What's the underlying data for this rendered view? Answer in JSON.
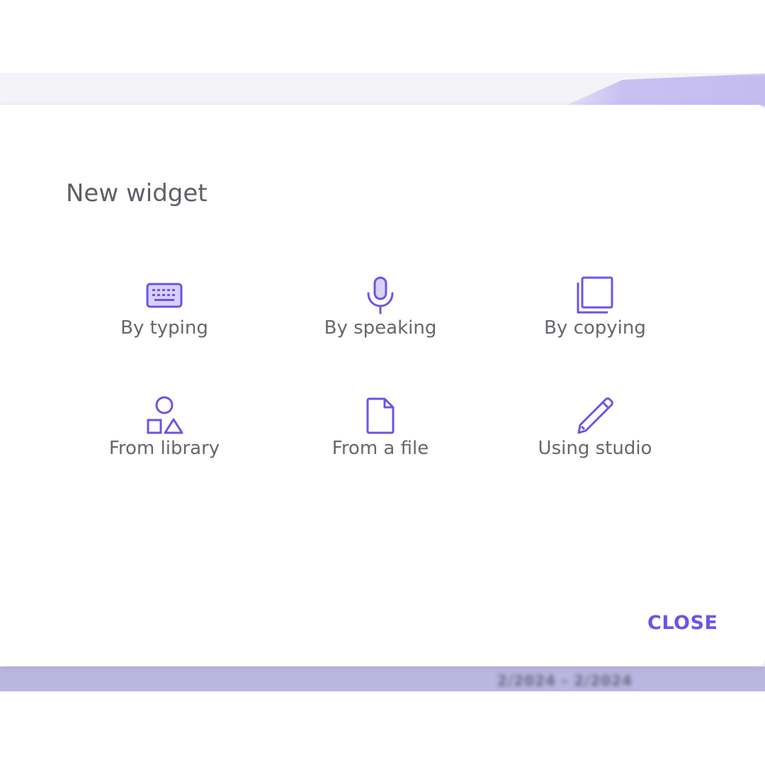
{
  "dialog": {
    "title": "New widget",
    "close_label": "CLOSE"
  },
  "options": [
    {
      "label": "By typing",
      "icon": "keyboard-icon"
    },
    {
      "label": "By speaking",
      "icon": "microphone-icon"
    },
    {
      "label": "By copying",
      "icon": "copy-icon"
    },
    {
      "label": "From library",
      "icon": "shapes-icon"
    },
    {
      "label": "From a file",
      "icon": "file-icon"
    },
    {
      "label": "Using studio",
      "icon": "pencil-icon"
    }
  ],
  "background": {
    "blurred_text": "2/2024 - 2/2024"
  },
  "colors": {
    "accent": "#6a55e6",
    "label_text": "#66666c",
    "title_text": "#5f5f66",
    "bottom_band": "#b9b6df"
  }
}
